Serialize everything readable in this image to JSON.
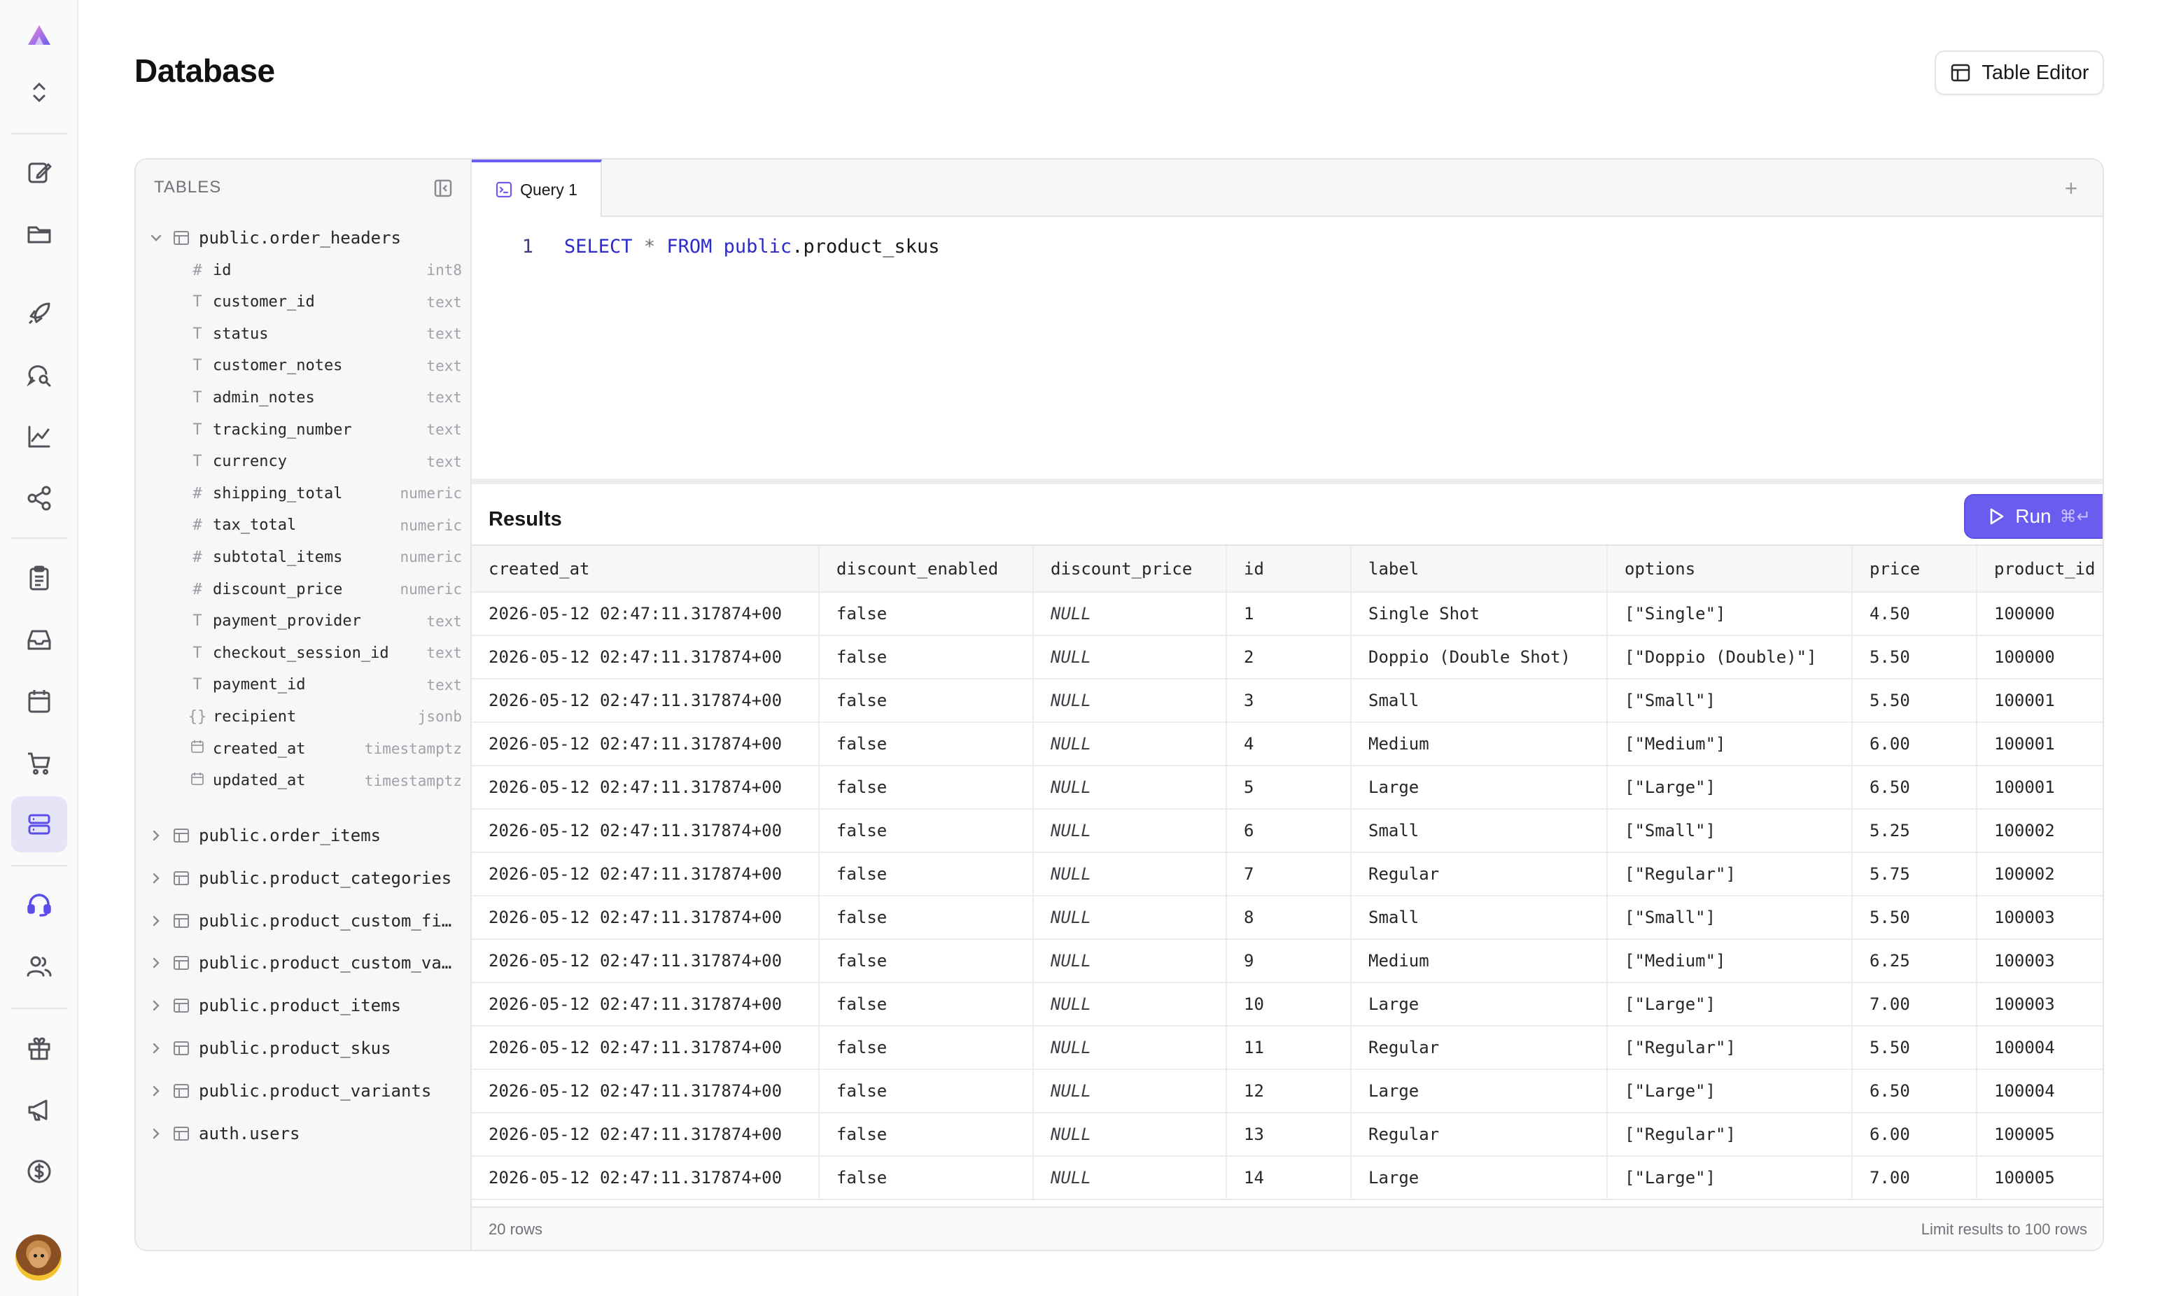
{
  "app": {
    "accent": "#6b5cf0"
  },
  "rail": {
    "items": [
      {
        "icon": "logo-icon"
      },
      {
        "icon": "chevron-up-down-icon"
      },
      {
        "icon": "edit-icon"
      },
      {
        "icon": "folder-icon"
      },
      {
        "icon": "rocket-icon"
      },
      {
        "icon": "search-chat-icon"
      },
      {
        "icon": "chart-icon"
      },
      {
        "icon": "share-icon"
      },
      {
        "icon": "clipboard-icon"
      },
      {
        "icon": "inbox-icon"
      },
      {
        "icon": "calendar-icon"
      },
      {
        "icon": "cart-icon"
      },
      {
        "icon": "database-icon",
        "active": true
      },
      {
        "icon": "headset-icon"
      },
      {
        "icon": "users-icon"
      },
      {
        "icon": "gift-icon"
      },
      {
        "icon": "megaphone-icon"
      },
      {
        "icon": "dollar-icon"
      }
    ]
  },
  "header": {
    "title": "Database",
    "table_editor_label": "Table Editor"
  },
  "tree": {
    "heading": "TABLES",
    "expanded_table": "public.order_headers",
    "columns": [
      {
        "icon": "#",
        "name": "id",
        "type": "int8"
      },
      {
        "icon": "T",
        "name": "customer_id",
        "type": "text"
      },
      {
        "icon": "T",
        "name": "status",
        "type": "text"
      },
      {
        "icon": "T",
        "name": "customer_notes",
        "type": "text"
      },
      {
        "icon": "T",
        "name": "admin_notes",
        "type": "text"
      },
      {
        "icon": "T",
        "name": "tracking_number",
        "type": "text"
      },
      {
        "icon": "T",
        "name": "currency",
        "type": "text"
      },
      {
        "icon": "#",
        "name": "shipping_total",
        "type": "numeric"
      },
      {
        "icon": "#",
        "name": "tax_total",
        "type": "numeric"
      },
      {
        "icon": "#",
        "name": "subtotal_items",
        "type": "numeric"
      },
      {
        "icon": "#",
        "name": "discount_price",
        "type": "numeric"
      },
      {
        "icon": "T",
        "name": "payment_provider",
        "type": "text"
      },
      {
        "icon": "T",
        "name": "checkout_session_id",
        "type": "text"
      },
      {
        "icon": "T",
        "name": "payment_id",
        "type": "text"
      },
      {
        "icon": "{}",
        "name": "recipient",
        "type": "jsonb"
      },
      {
        "icon": "cal",
        "name": "created_at",
        "type": "timestamptz"
      },
      {
        "icon": "cal",
        "name": "updated_at",
        "type": "timestamptz"
      }
    ],
    "other_tables": [
      "public.order_items",
      "public.product_categories",
      "public.product_custom_fi…",
      "public.product_custom_va…",
      "public.product_items",
      "public.product_skus",
      "public.product_variants",
      "auth.users"
    ]
  },
  "editor": {
    "tab_label": "Query 1",
    "add_tab": "+",
    "line_number": "1",
    "sql": {
      "select": "SELECT",
      "star": "*",
      "from": "FROM",
      "schema": "public",
      "rest": ".product_skus"
    }
  },
  "results": {
    "title": "Results",
    "run_label": "Run",
    "run_shortcut": "⌘↵",
    "columns": [
      "created_at",
      "discount_enabled",
      "discount_price",
      "id",
      "label",
      "options",
      "price",
      "product_id"
    ],
    "rows": [
      [
        "2026-05-12 02:47:11.317874+00",
        "false",
        "NULL",
        "1",
        "Single Shot",
        "[\"Single\"]",
        "4.50",
        "100000"
      ],
      [
        "2026-05-12 02:47:11.317874+00",
        "false",
        "NULL",
        "2",
        "Doppio (Double Shot)",
        "[\"Doppio (Double)\"]",
        "5.50",
        "100000"
      ],
      [
        "2026-05-12 02:47:11.317874+00",
        "false",
        "NULL",
        "3",
        "Small",
        "[\"Small\"]",
        "5.50",
        "100001"
      ],
      [
        "2026-05-12 02:47:11.317874+00",
        "false",
        "NULL",
        "4",
        "Medium",
        "[\"Medium\"]",
        "6.00",
        "100001"
      ],
      [
        "2026-05-12 02:47:11.317874+00",
        "false",
        "NULL",
        "5",
        "Large",
        "[\"Large\"]",
        "6.50",
        "100001"
      ],
      [
        "2026-05-12 02:47:11.317874+00",
        "false",
        "NULL",
        "6",
        "Small",
        "[\"Small\"]",
        "5.25",
        "100002"
      ],
      [
        "2026-05-12 02:47:11.317874+00",
        "false",
        "NULL",
        "7",
        "Regular",
        "[\"Regular\"]",
        "5.75",
        "100002"
      ],
      [
        "2026-05-12 02:47:11.317874+00",
        "false",
        "NULL",
        "8",
        "Small",
        "[\"Small\"]",
        "5.50",
        "100003"
      ],
      [
        "2026-05-12 02:47:11.317874+00",
        "false",
        "NULL",
        "9",
        "Medium",
        "[\"Medium\"]",
        "6.25",
        "100003"
      ],
      [
        "2026-05-12 02:47:11.317874+00",
        "false",
        "NULL",
        "10",
        "Large",
        "[\"Large\"]",
        "7.00",
        "100003"
      ],
      [
        "2026-05-12 02:47:11.317874+00",
        "false",
        "NULL",
        "11",
        "Regular",
        "[\"Regular\"]",
        "5.50",
        "100004"
      ],
      [
        "2026-05-12 02:47:11.317874+00",
        "false",
        "NULL",
        "12",
        "Large",
        "[\"Large\"]",
        "6.50",
        "100004"
      ],
      [
        "2026-05-12 02:47:11.317874+00",
        "false",
        "NULL",
        "13",
        "Regular",
        "[\"Regular\"]",
        "6.00",
        "100005"
      ],
      [
        "2026-05-12 02:47:11.317874+00",
        "false",
        "NULL",
        "14",
        "Large",
        "[\"Large\"]",
        "7.00",
        "100005"
      ]
    ],
    "row_count": "20 rows",
    "limit_label": "Limit results to 100 rows"
  }
}
